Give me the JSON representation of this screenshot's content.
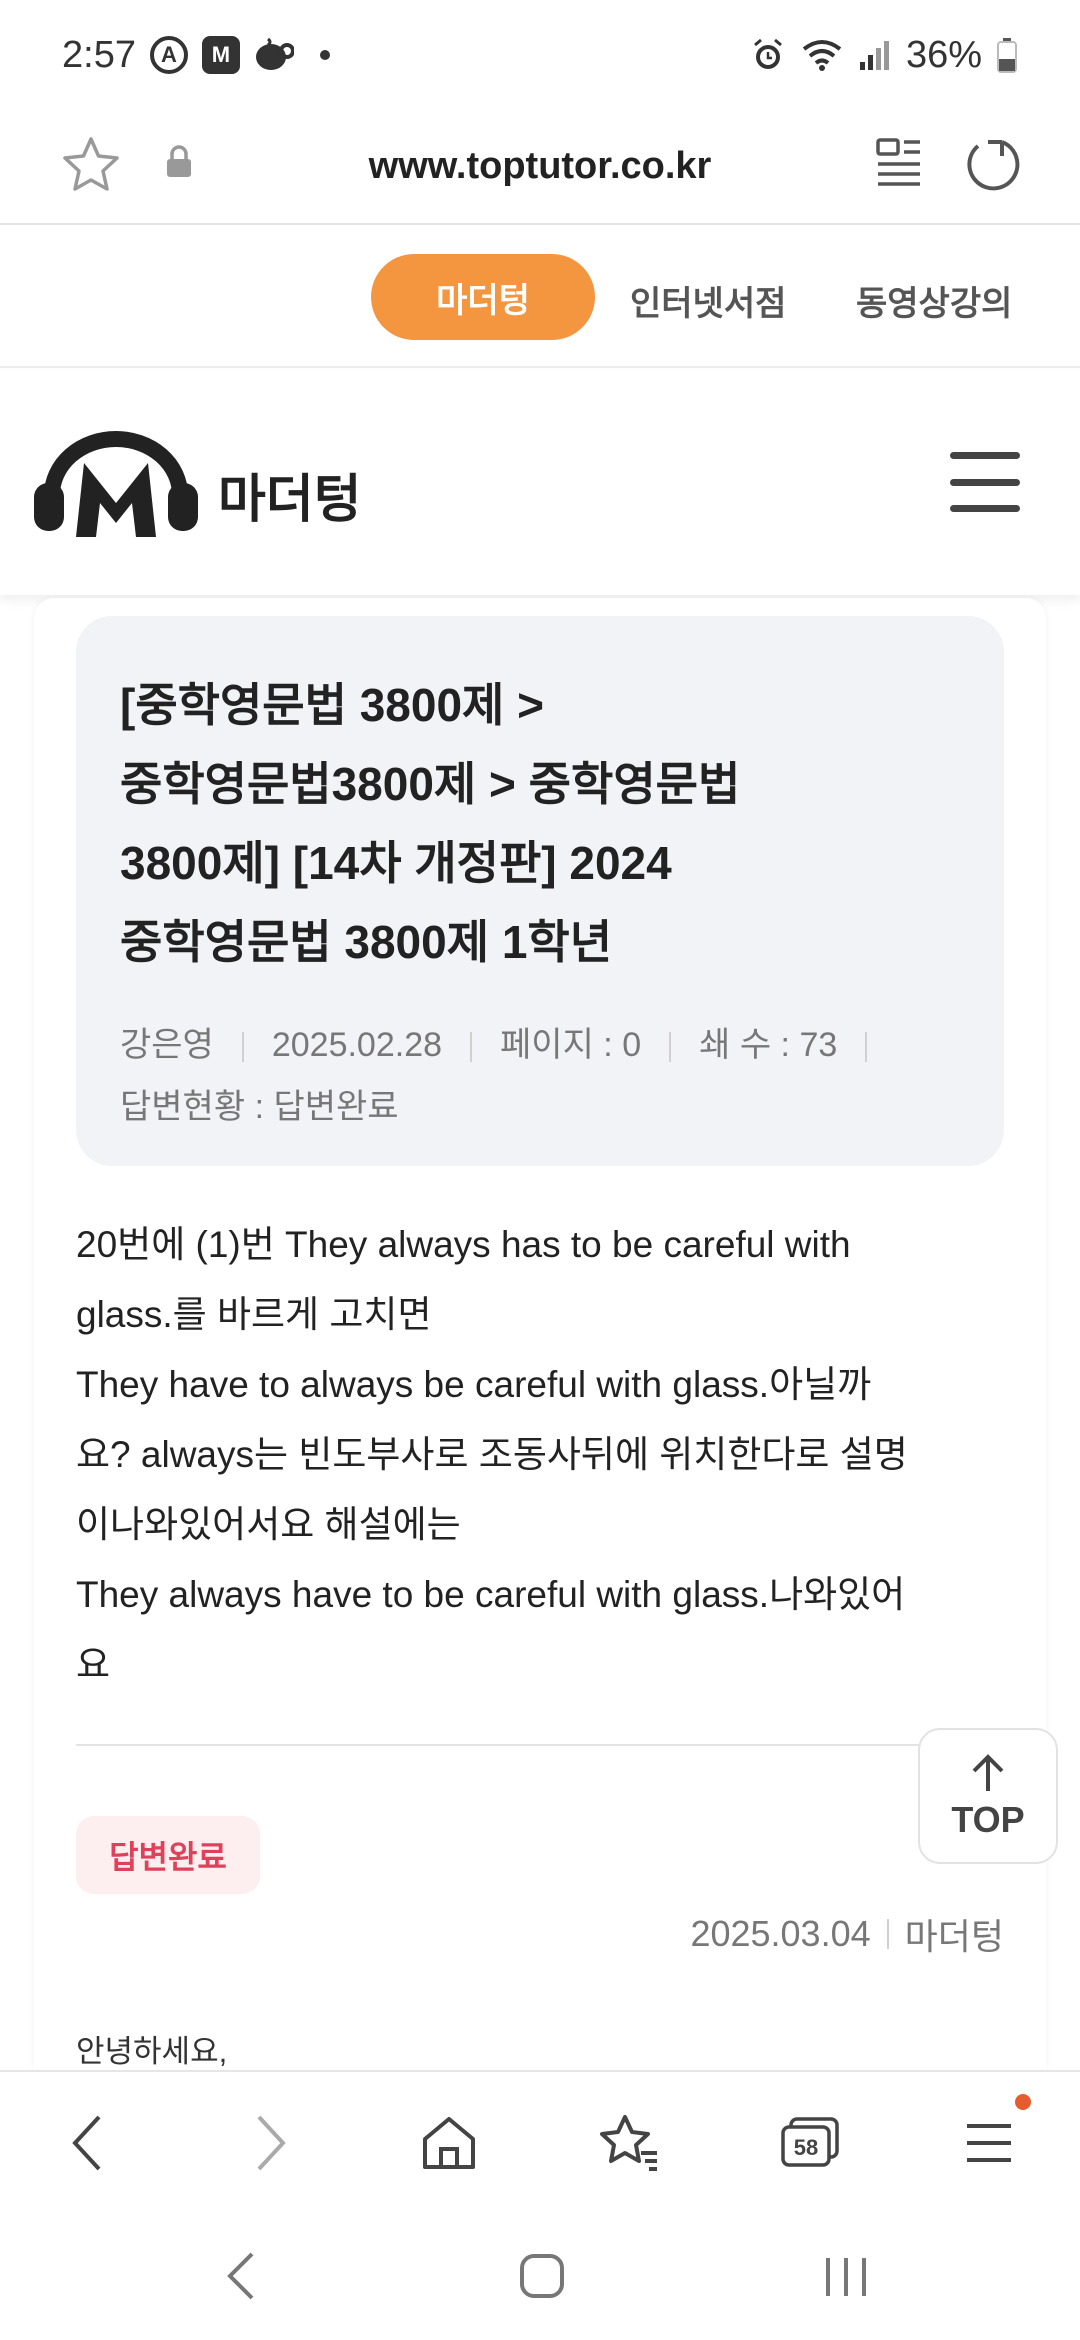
{
  "status_bar": {
    "time": "2:57",
    "battery": "36%",
    "icons": [
      "a-circle-icon",
      "m-app-icon",
      "coffee-icon",
      "notification-dot",
      "alarm-icon",
      "wifi-icon",
      "signal-icon",
      "battery-icon"
    ],
    "a_letter": "A",
    "m_letter": "M"
  },
  "browser": {
    "url": "www.toptutor.co.kr"
  },
  "top_nav": {
    "items": [
      {
        "label": "마더텅",
        "active": true
      },
      {
        "label": "인터넷서점",
        "active": false
      },
      {
        "label": "동영상강의",
        "active": false
      }
    ]
  },
  "site_header": {
    "logo_text": "마더텅"
  },
  "question": {
    "title_lines": [
      "[중학영문법 3800제 >",
      "중학영문법3800제 > 중학영문법",
      "3800제] [14차 개정판] 2024",
      "중학영문법 3800제 1학년"
    ],
    "author": "강은영",
    "date": "2025.02.28",
    "page": "페이지 : 0",
    "number": "쇄 수 : 73",
    "status": "답변현황 : 답변완료",
    "body_lines": [
      "20번에 (1)번 They always has to be careful with",
      "glass.를 바르게 고치면",
      "They have to always be careful with glass.아닐까",
      "요?  always는 빈도부사로 조동사뒤에 위치한다로 설명",
      "이나와있어서요 해설에는",
      "They always have to be careful with glass.나와있어",
      "요"
    ]
  },
  "answer": {
    "badge": "답변완료",
    "date": "2025.03.04",
    "author": "마더텅",
    "greeting": "안녕하세요,"
  },
  "top_button": {
    "label": "TOP"
  },
  "bottom_bar": {
    "tab_count": "58",
    "colors": {
      "notification": "#e65c2e",
      "accent": "#f3963f"
    }
  }
}
